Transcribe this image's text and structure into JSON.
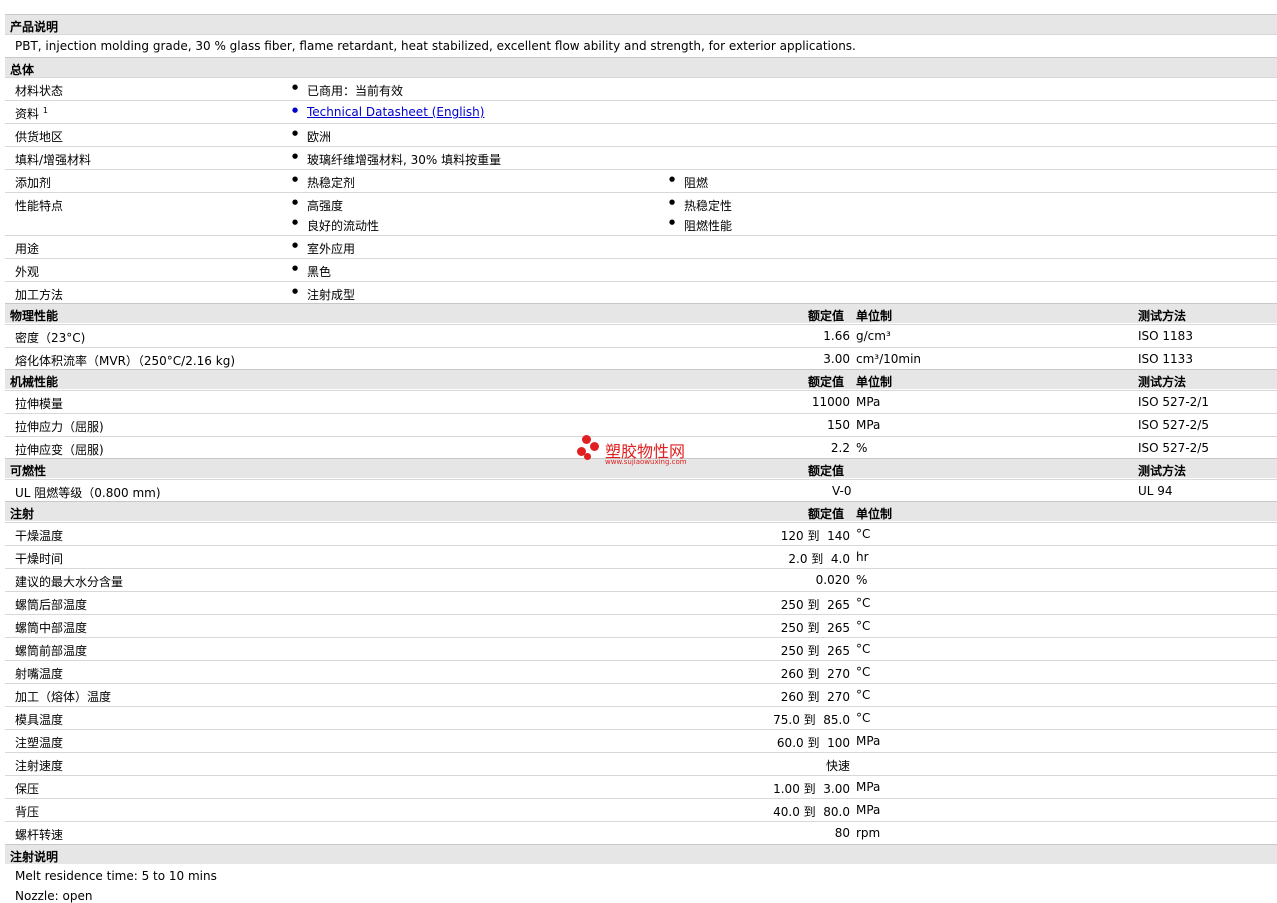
{
  "sections": {
    "desc": {
      "title": "产品说明",
      "text": "PBT, injection molding grade, 30 % glass fiber, flame retardant, heat stabilized, excellent flow ability and strength, for exterior applications."
    },
    "general": {
      "title": "总体",
      "rows": [
        {
          "label": "材料状态",
          "values": [
            "已商用：当前有效"
          ]
        },
        {
          "label": "资料",
          "sup": "1",
          "link": "Technical Datasheet (English)"
        },
        {
          "label": "供货地区",
          "values": [
            "欧洲"
          ]
        },
        {
          "label": "填料/增强材料",
          "values": [
            "玻璃纤维增强材料, 30% 填料按重量"
          ]
        },
        {
          "label": "添加剂",
          "values": [
            "热稳定剂",
            "阻燃"
          ]
        },
        {
          "label": "性能特点",
          "values": [
            "高强度",
            "热稳定性",
            "良好的流动性",
            "阻燃性能"
          ]
        },
        {
          "label": "用途",
          "values": [
            "室外应用"
          ]
        },
        {
          "label": "外观",
          "values": [
            "黑色"
          ]
        },
        {
          "label": "加工方法",
          "values": [
            "注射成型"
          ]
        }
      ]
    },
    "physical": {
      "title": "物理性能",
      "col_value": "额定值",
      "col_unit": "单位制",
      "col_method": "测试方法",
      "rows": [
        {
          "label": "密度（23°C)",
          "value": "1.66",
          "unit": "g/cm³",
          "method": "ISO 1183"
        },
        {
          "label": "熔化体积流率（MVR）（250°C/2.16 kg)",
          "value": "3.00",
          "unit": "cm³/10min",
          "method": "ISO 1133"
        }
      ]
    },
    "mechanical": {
      "title": "机械性能",
      "col_value": "额定值",
      "col_unit": "单位制",
      "col_method": "测试方法",
      "rows": [
        {
          "label": "拉伸模量",
          "value": "11000",
          "unit": "MPa",
          "method": "ISO 527-2/1"
        },
        {
          "label": "拉伸应力（屈服)",
          "value": "150",
          "unit": "MPa",
          "method": "ISO 527-2/5"
        },
        {
          "label": "拉伸应变（屈服)",
          "value": "2.2",
          "unit": "%",
          "method": "ISO 527-2/5"
        }
      ]
    },
    "flammability": {
      "title": "可燃性",
      "col_value": "额定值",
      "col_method": "测试方法",
      "rows": [
        {
          "label": "UL 阻燃等级（0.800 mm)",
          "value": "V-0",
          "method": "UL 94"
        }
      ]
    },
    "injection": {
      "title": "注射",
      "col_value": "额定值",
      "col_unit": "单位制",
      "rows": [
        {
          "label": "干燥温度",
          "value": "120 到  140",
          "unit": "°C"
        },
        {
          "label": "干燥时间",
          "value": "2.0 到  4.0",
          "unit": "hr"
        },
        {
          "label": "建议的最大水分含量",
          "value": "0.020",
          "unit": "%"
        },
        {
          "label": "螺筒后部温度",
          "value": "250 到  265",
          "unit": "°C"
        },
        {
          "label": "螺筒中部温度",
          "value": "250 到  265",
          "unit": "°C"
        },
        {
          "label": "螺筒前部温度",
          "value": "250 到  265",
          "unit": "°C"
        },
        {
          "label": "射嘴温度",
          "value": "260 到  270",
          "unit": "°C"
        },
        {
          "label": "加工（熔体）温度",
          "value": "260 到  270",
          "unit": "°C"
        },
        {
          "label": "模具温度",
          "value": "75.0 到  85.0",
          "unit": "°C"
        },
        {
          "label": "注塑温度",
          "value": "60.0 到  100",
          "unit": "MPa"
        },
        {
          "label": "注射速度",
          "value": "快速",
          "unit": ""
        },
        {
          "label": "保压",
          "value": "1.00 到  3.00",
          "unit": "MPa"
        },
        {
          "label": "背压",
          "value": "40.0 到  80.0",
          "unit": "MPa"
        },
        {
          "label": "螺杆转速",
          "value": "80",
          "unit": "rpm"
        }
      ]
    },
    "notes": {
      "title": "注射说明",
      "lines": [
        "Melt residence time: 5 to 10 mins",
        "Nozzle: open"
      ]
    }
  },
  "watermark": {
    "name": "塑胶物性网",
    "url": "www.sujiaowuxing.com",
    "color": "#e02020"
  }
}
